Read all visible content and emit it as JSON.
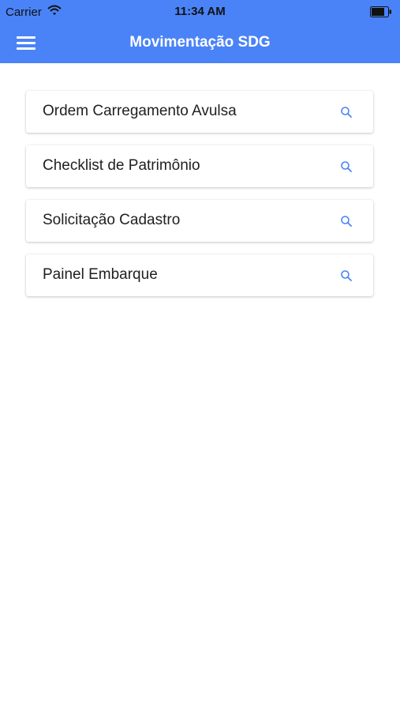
{
  "status_bar": {
    "carrier": "Carrier",
    "time": "11:34 AM",
    "icons": [
      "wifi-icon",
      "battery-icon"
    ]
  },
  "header": {
    "title": "Movimentação SDG",
    "menu_icon": "hamburger-menu-icon",
    "color": "#4a83f7"
  },
  "menu": {
    "items": [
      {
        "label": "Ordem Carregamento Avulsa",
        "icon": "search-icon"
      },
      {
        "label": "Checklist de Patrimônio",
        "icon": "search-icon"
      },
      {
        "label": "Solicitação Cadastro",
        "icon": "search-icon"
      },
      {
        "label": "Painel Embarque",
        "icon": "search-icon"
      }
    ],
    "icon_color": "#4a83f7"
  }
}
